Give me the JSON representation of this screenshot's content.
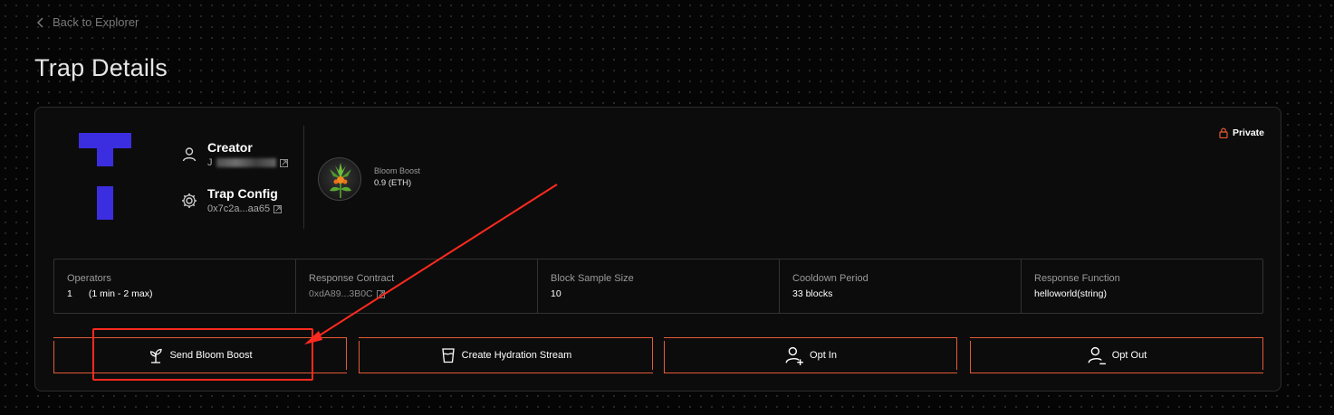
{
  "nav": {
    "back_label": "Back to Explorer"
  },
  "page": {
    "title": "Trap Details"
  },
  "creator": {
    "title": "Creator",
    "address_prefix": "J"
  },
  "trap_config": {
    "title": "Trap Config",
    "address": "0x7c2a...aa65"
  },
  "bloom_boost": {
    "name": "Bloom Boost",
    "value": "0.9 (ETH)"
  },
  "visibility": {
    "label": "Private"
  },
  "stats": [
    {
      "label": "Operators",
      "value": "1",
      "extra": "(1 min - 2 max)"
    },
    {
      "label": "Response Contract",
      "value": "0xdA89...3B0C"
    },
    {
      "label": "Block Sample Size",
      "value": "10"
    },
    {
      "label": "Cooldown Period",
      "value": "33 blocks"
    },
    {
      "label": "Response Function",
      "value": "helloworld(string)"
    }
  ],
  "actions": [
    {
      "label": "Send Bloom Boost",
      "icon": "sprout-icon"
    },
    {
      "label": "Create Hydration Stream",
      "icon": "cup-icon"
    },
    {
      "label": "Opt In",
      "icon": "user-plus-icon"
    },
    {
      "label": "Opt Out",
      "icon": "user-minus-icon"
    }
  ],
  "colors": {
    "accent": "#e35b37",
    "logo": "#3b2ee0",
    "annotation": "#ff2a1f",
    "background": "#050505"
  }
}
